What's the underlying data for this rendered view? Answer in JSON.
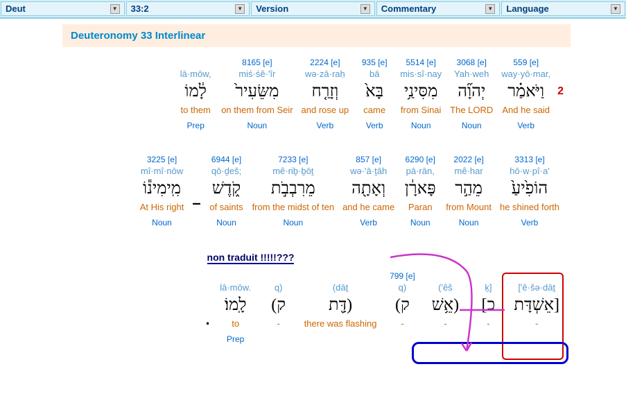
{
  "nav": {
    "book": "Deut",
    "chapter": "33:2",
    "version": "Version",
    "commentary": "Commentary",
    "language": "Language"
  },
  "title": "Deuteronomy 33 Interlinear",
  "verse_num": "2",
  "annotation": "non traduit !!!!!???",
  "row1": [
    {
      "s": "559",
      "e": "[e]",
      "tr": "way·yō·mar,",
      "he": "וַיֹּאמַ֗ר",
      "gl": "And he said",
      "pos": "Verb"
    },
    {
      "s": "3068",
      "e": "[e]",
      "tr": "Yah·weh",
      "he": "יְהוָ֞ה",
      "gl": "The LORD",
      "pos": "Noun"
    },
    {
      "s": "5514",
      "e": "[e]",
      "tr": "mis·sî·nay",
      "he": "מִסִּינַ֥י",
      "gl": "from Sinai",
      "pos": "Noun"
    },
    {
      "s": "935",
      "e": "[e]",
      "tr": "bā",
      "he": "בָּא֙",
      "gl": "came",
      "pos": "Verb"
    },
    {
      "s": "2224",
      "e": "[e]",
      "tr": "wə·zā·raḥ",
      "he": "וְזָרַ֤ח",
      "gl": "and rose up",
      "pos": "Verb"
    },
    {
      "s": "8165",
      "e": "[e]",
      "tr": "miś·śê·'îr",
      "he": "מִשֵּׂעִיר֙",
      "gl": "on them from Seir",
      "pos": "Noun"
    },
    {
      "s": "",
      "e": "",
      "tr": "lā·mōw,",
      "he": "לָ֔מוֹ",
      "gl": "to them",
      "pos": "Prep"
    }
  ],
  "row2": [
    {
      "s": "3313",
      "e": "[e]",
      "tr": "hō·w·pî·a'",
      "he": "הוֹפִ֙יעַ֙",
      "gl": "he shined forth",
      "pos": "Verb"
    },
    {
      "s": "2022",
      "e": "[e]",
      "tr": "mê·har",
      "he": "מֵהַ֣ר",
      "gl": "from Mount",
      "pos": "Noun"
    },
    {
      "s": "6290",
      "e": "[e]",
      "tr": "pā·rān,",
      "he": "פָּארָ֔ן",
      "gl": "Paran",
      "pos": "Noun"
    },
    {
      "s": "857",
      "e": "[e]",
      "tr": "wə·'ā·ṯāh",
      "he": "וְאָתָ֖ה",
      "gl": "and he came",
      "pos": "Verb"
    },
    {
      "s": "7233",
      "e": "[e]",
      "tr": "mê·riḇ·ḇōṯ",
      "he": "מֵרִבְבֹ֣ת",
      "gl": "from the midst of ten",
      "pos": "Noun"
    },
    {
      "s": "6944",
      "e": "[e]",
      "tr": "qō·ḏeš;",
      "he": "קֹ֑דֶשׁ",
      "gl": "of saints",
      "pos": "Noun"
    },
    {
      "s": "3225",
      "e": "[e]",
      "tr": "mî·mî·nōw",
      "he": "מִֽימִינ֕וֹ",
      "gl": "At His right",
      "pos": "Noun"
    }
  ],
  "row3": [
    {
      "s": "",
      "e": "",
      "tr": "['ê·šə·dāṯ",
      "he": "[אֵשְׁדָּת",
      "gl": " - ",
      "pos": ""
    },
    {
      "s": "",
      "e": "",
      "tr": "ḵ]",
      "he": "כ]",
      "gl": " - ",
      "pos": ""
    },
    {
      "s": "",
      "e": "",
      "tr": "('êš",
      "he": "(אֵ֥שׁ",
      "gl": " - ",
      "pos": ""
    },
    {
      "s": "799",
      "e": "[e]",
      "tr": "q)",
      "he": "ק)",
      "gl": " - ",
      "pos": ""
    },
    {
      "s": "",
      "e": "",
      "tr": "(dāṯ",
      "he": "(דָּ֖ת",
      "gl": "there was flashing",
      "pos": ""
    },
    {
      "s": "",
      "e": "",
      "tr": "q)",
      "he": "ק)",
      "gl": "-",
      "pos": ""
    },
    {
      "s": "",
      "e": "",
      "tr": "lā·mōw.",
      "he": "לָֽמוֹ׃",
      "gl": "to",
      "pos": "Prep"
    }
  ],
  "dash": "–",
  "period": "."
}
